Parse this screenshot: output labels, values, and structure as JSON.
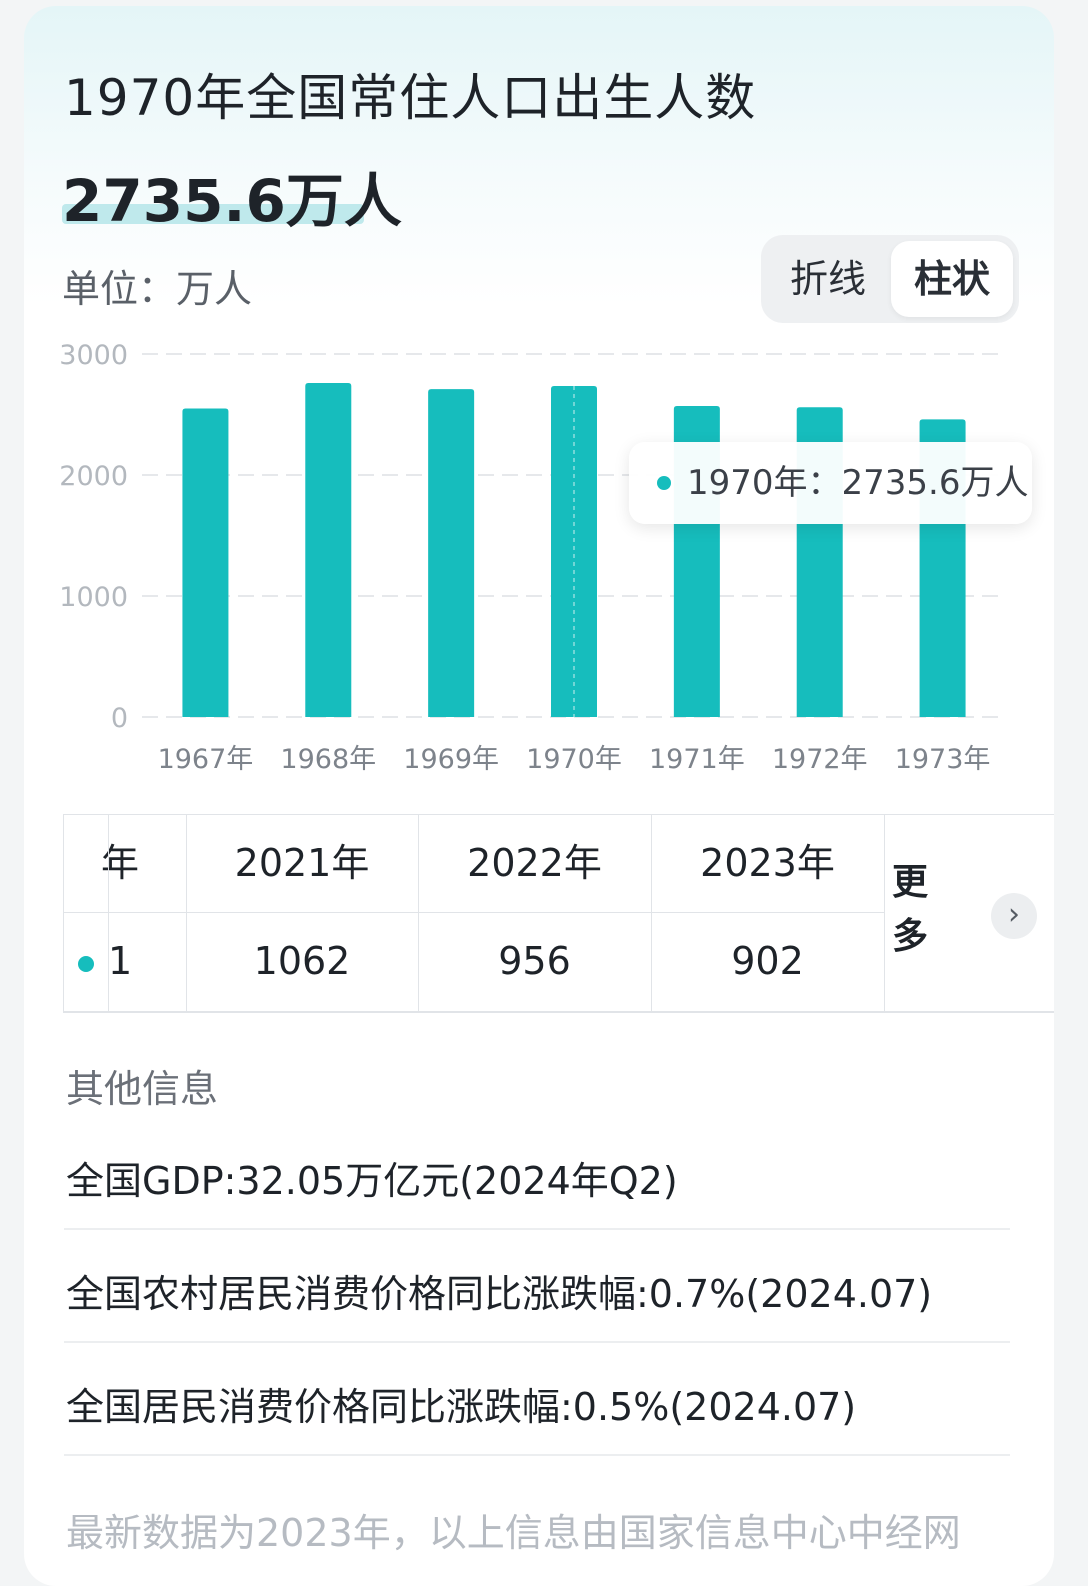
{
  "header": {
    "title": "1970年全国常住人口出生人数",
    "highlight_value": "2735.6万人",
    "unit_label": "单位：万人"
  },
  "chart_toggle": {
    "options": [
      "折线",
      "柱状"
    ],
    "selected": "柱状"
  },
  "chart_data": {
    "type": "bar",
    "categories": [
      "1967年",
      "1968年",
      "1969年",
      "1970年",
      "1971年",
      "1972年",
      "1973年"
    ],
    "values": [
      2550,
      2760,
      2710,
      2735.6,
      2570,
      2560,
      2460
    ],
    "ylim": [
      0,
      3000
    ],
    "yticks": [
      "0",
      "1000",
      "2000",
      "3000"
    ],
    "bar_color": "#16bdbd",
    "grid": true,
    "selected_index": 3,
    "tooltip": "1970年：2735.6万人"
  },
  "table": {
    "header_first": "年",
    "headers": [
      "2021年",
      "2022年",
      "2023年"
    ],
    "row_first": "1",
    "values": [
      "1062",
      "956",
      "902"
    ],
    "more_label": "更多",
    "more_icon": "chevron-right-icon"
  },
  "other_info": {
    "title": "其他信息",
    "items": [
      "全国GDP:32.05万亿元(2024年Q2)",
      "全国农村居民消费价格同比涨跌幅:0.7%(2024.07)",
      "全国居民消费价格同比涨跌幅:0.5%(2024.07)"
    ],
    "footnote": "最新数据为2023年，以上信息由国家信息中心中经网"
  },
  "colors": {
    "accent": "#16bdbd",
    "text": "#1e2329",
    "muted": "#6b7078"
  }
}
